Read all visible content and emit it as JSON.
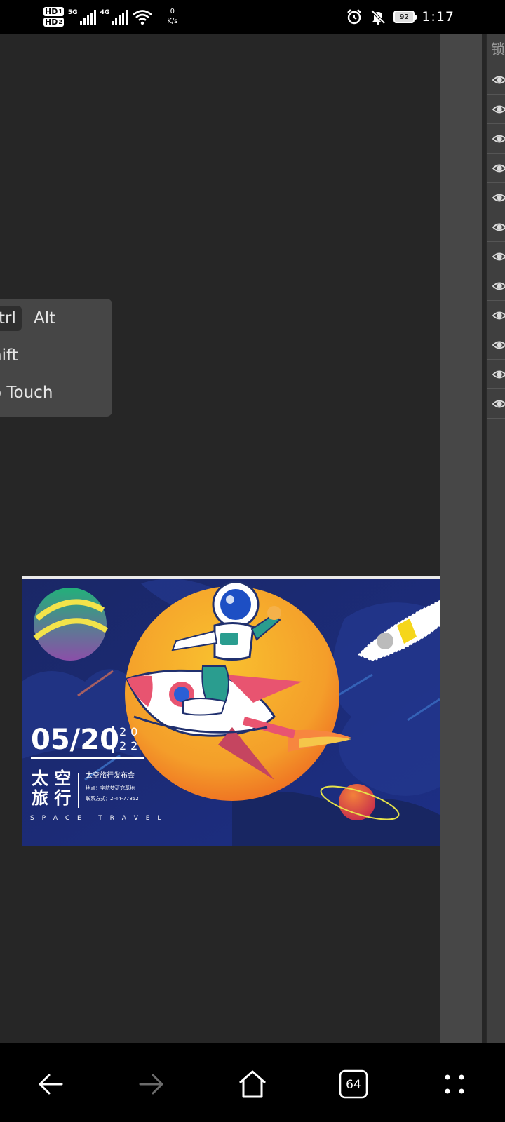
{
  "status_bar": {
    "sim1": "HD",
    "sim1_index": "1",
    "sim2": "HD",
    "sim2_index": "2",
    "net1": "5G",
    "net2": "4G",
    "speed_value": "0",
    "speed_unit": "K/s",
    "battery": "92",
    "time": "1:17"
  },
  "layers_panel": {
    "header": "锁",
    "rows": 12
  },
  "modifier_popup": {
    "ctrl": "trl",
    "alt": "Alt",
    "shift": "hift",
    "touch": "o Touch"
  },
  "poster": {
    "date": "05/20",
    "year_top": "20",
    "year_bottom": "22",
    "title_line1": "太 空",
    "title_line2": "旅 行",
    "event": "太空旅行发布会",
    "address": "地点：宇航梦研究基地",
    "contact": "联系方式：2-44-77852",
    "tagline": "S P A C E   T R A V E L"
  },
  "bottom_nav": {
    "zoom": "64"
  },
  "colors": {
    "canvas_bg": "#262626",
    "poster_navy": "#1c2a6e",
    "sun_orange": "#f4a42a",
    "planet_green": "#2cb67d"
  }
}
